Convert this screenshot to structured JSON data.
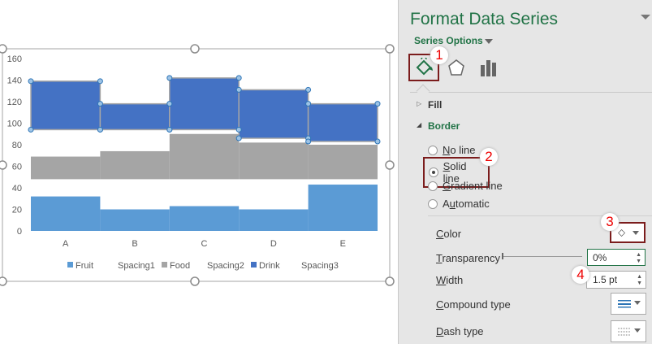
{
  "chart_data": {
    "type": "bar",
    "stacked": true,
    "categories": [
      "A",
      "B",
      "C",
      "D",
      "E"
    ],
    "ylim": [
      0,
      160
    ],
    "yticks": [
      "0",
      "20",
      "40",
      "60",
      "80",
      "100",
      "120",
      "140",
      "160"
    ],
    "series": [
      {
        "name": "Fruit",
        "values": [
          32,
          20,
          23,
          20,
          43
        ],
        "color": "#5b9bd5"
      },
      {
        "name": "Spacing1",
        "values": [
          16,
          28,
          25,
          28,
          5
        ],
        "color": "none"
      },
      {
        "name": "Food",
        "values": [
          21,
          26,
          42,
          34,
          32
        ],
        "color": "#a5a5a5"
      },
      {
        "name": "Spacing2",
        "values": [
          25,
          20,
          4,
          4,
          3
        ],
        "color": "none"
      },
      {
        "name": "Drink",
        "values": [
          45,
          24,
          48,
          45,
          35
        ],
        "color": "#4472c4"
      },
      {
        "name": "Spacing3",
        "values": [],
        "color": "none"
      }
    ],
    "legend": "bottom",
    "grid": false,
    "selected_series": "Drink"
  },
  "pane": {
    "title": "Format Data Series",
    "series_options": "Series Options",
    "fill": "Fill",
    "border": "Border",
    "radios": [
      {
        "label": "No line",
        "checked": false
      },
      {
        "label": "Solid line",
        "checked": true
      },
      {
        "label": "Gradient line",
        "checked": false
      },
      {
        "label": "Automatic",
        "checked": false
      }
    ],
    "color_label": "Color",
    "transparency_label": "Transparency",
    "transparency_value": "0%",
    "width_label": "Width",
    "width_value": "1.5 pt",
    "compound_label": "Compound type",
    "dash_label": "Dash type",
    "callouts": [
      "1",
      "2",
      "3",
      "4"
    ],
    "accent": "#217346",
    "highlight": "#7b1c1c"
  }
}
